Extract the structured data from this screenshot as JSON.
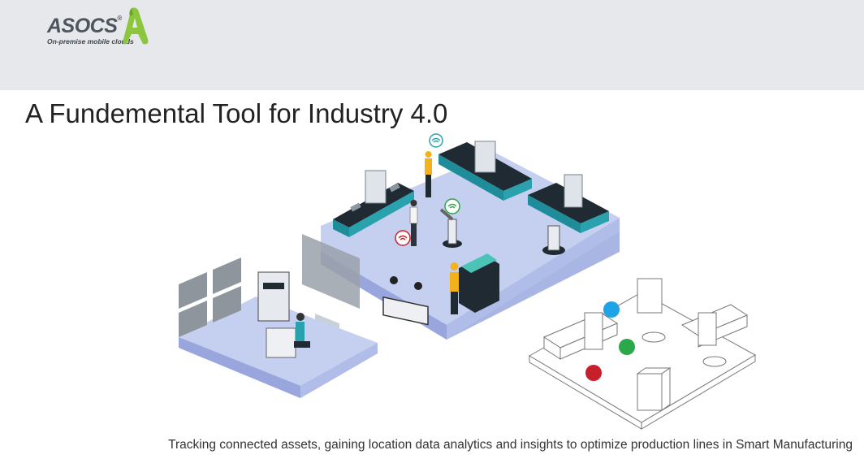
{
  "logo": {
    "brand": "ASOCS",
    "registered": "®",
    "tagline": "On-premise mobile clouds"
  },
  "title": "A Fundemental Tool for Industry 4.0",
  "caption": "Tracking connected assets, gaining location data analytics and  insights to optimize production lines in Smart Manufacturing",
  "colors": {
    "header_bg": "#e6e8eb",
    "logo_green": "#8cc63f",
    "platform": "#b9c4ea",
    "conveyor_teal": "#1e8c99",
    "dot_blue": "#1fa3e8",
    "dot_green": "#2aa84a",
    "dot_red": "#c8202a"
  }
}
